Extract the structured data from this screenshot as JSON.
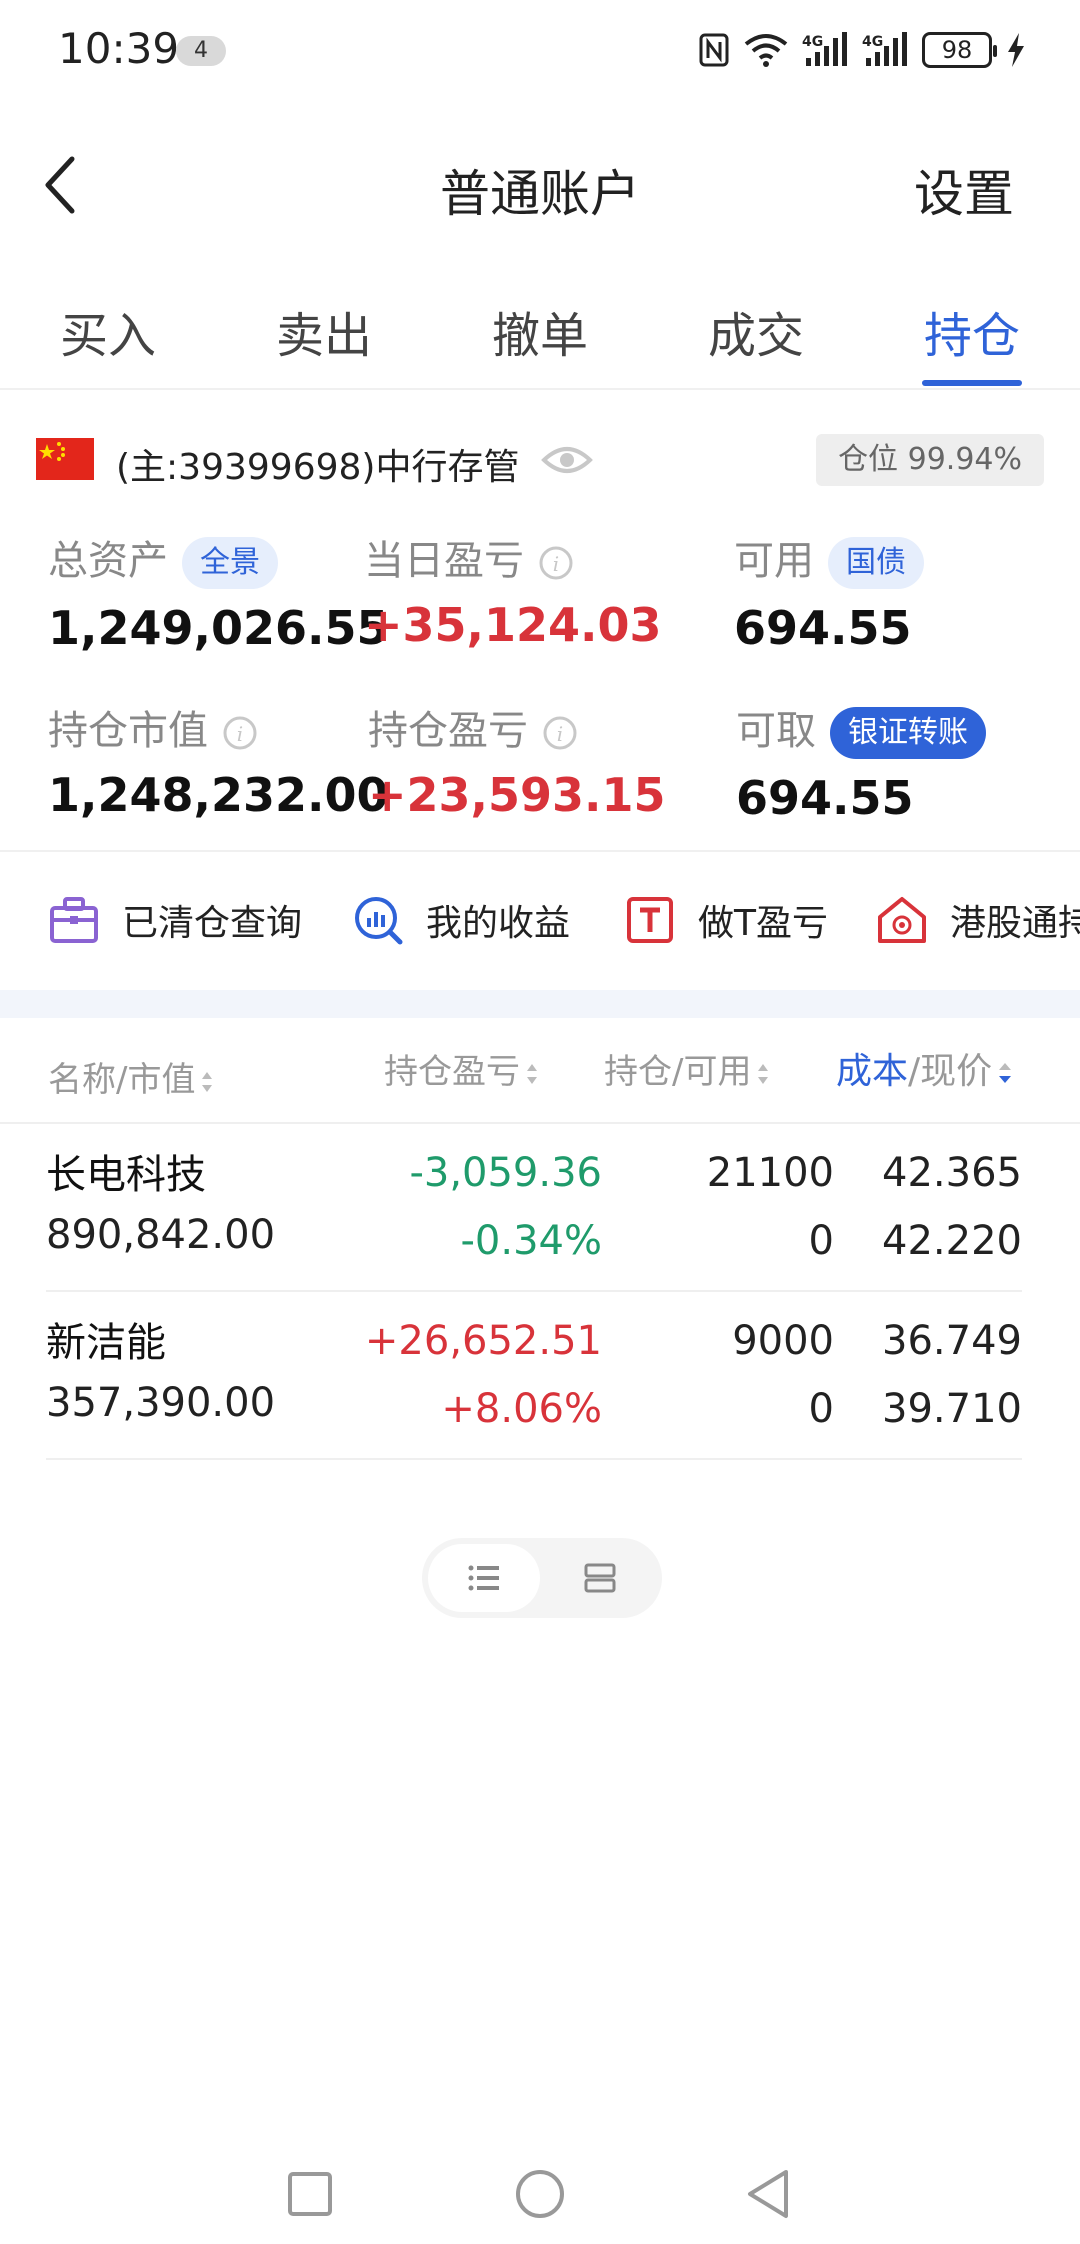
{
  "status": {
    "time": "10:39",
    "notif_count": "4",
    "battery": "98"
  },
  "header": {
    "title": "普通账户",
    "settings": "设置"
  },
  "tabs": [
    {
      "label": "买入"
    },
    {
      "label": "卖出"
    },
    {
      "label": "撤单"
    },
    {
      "label": "成交"
    },
    {
      "label": "持仓",
      "active": true
    }
  ],
  "account": {
    "name": "(主:39399698)中行存管",
    "position_label": "仓位",
    "position_value": "99.94%"
  },
  "metrics": {
    "total_assets": {
      "label": "总资产",
      "pill": "全景",
      "value": "1,249,026.55"
    },
    "daily_pnl": {
      "label": "当日盈亏",
      "value": "+35,124.03"
    },
    "available": {
      "label": "可用",
      "pill": "国债",
      "value": "694.55"
    },
    "market_value": {
      "label": "持仓市值",
      "value": "1,248,232.00"
    },
    "position_pnl": {
      "label": "持仓盈亏",
      "value": "+23,593.15"
    },
    "withdrawable": {
      "label": "可取",
      "pill": "银证转账",
      "value": "694.55"
    }
  },
  "quick_links": [
    {
      "label": "已清仓查询",
      "icon": "briefcase-icon"
    },
    {
      "label": "我的收益",
      "icon": "chart-search-icon"
    },
    {
      "label": "做T盈亏",
      "icon": "t-box-icon"
    },
    {
      "label": "港股通持",
      "icon": "hk-home-icon"
    }
  ],
  "table": {
    "headers": {
      "name": "名称/市值",
      "pnl": "持仓盈亏",
      "holding": "持仓/可用",
      "cost_a": "成本",
      "cost_b": "/现价"
    },
    "rows": [
      {
        "name": "长电科技",
        "market_value": "890,842.00",
        "pnl": "-3,059.36",
        "pnl_pct": "-0.34%",
        "holding": "21100",
        "available": "0",
        "cost": "42.365",
        "price": "42.220",
        "trend": "down"
      },
      {
        "name": "新洁能",
        "market_value": "357,390.00",
        "pnl": "+26,652.51",
        "pnl_pct": "+8.06%",
        "holding": "9000",
        "available": "0",
        "cost": "36.749",
        "price": "39.710",
        "trend": "up"
      }
    ]
  },
  "colors": {
    "accent": "#2f63d8",
    "gain": "#d8333a",
    "loss": "#1f9b6b"
  }
}
